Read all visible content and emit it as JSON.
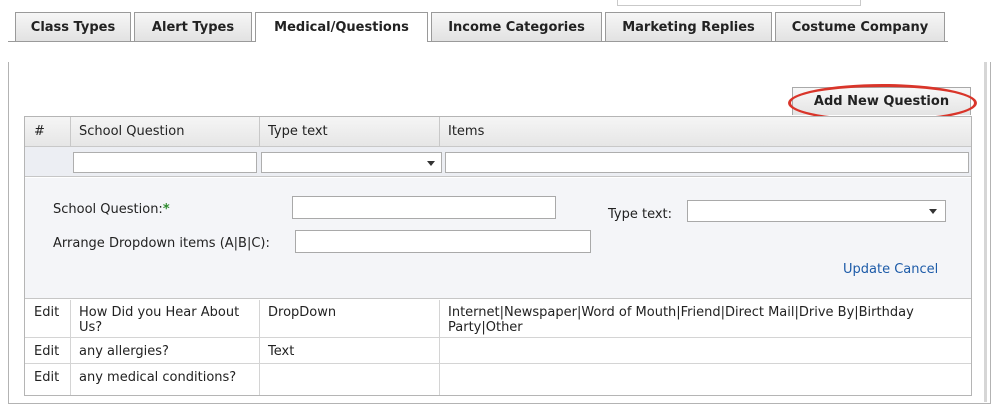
{
  "tabs": [
    {
      "label": "Class Types",
      "active": false
    },
    {
      "label": "Alert Types",
      "active": false
    },
    {
      "label": "Medical/Questions",
      "active": true
    },
    {
      "label": "Income Categories",
      "active": false
    },
    {
      "label": "Marketing Replies",
      "active": false
    },
    {
      "label": "Costume Company",
      "active": false
    }
  ],
  "add_button_label": "Add New Question",
  "grid": {
    "headers": [
      "#",
      "School Question",
      "Type text",
      "Items"
    ],
    "filters": {
      "school_question": "",
      "type_text": "",
      "items": ""
    }
  },
  "edit_form": {
    "question_label": "School Question:",
    "required_mark": "*",
    "question_value": "",
    "type_label": "Type text:",
    "type_value": "",
    "dropdown_items_label": "Arrange Dropdown items (A|B|C):",
    "dropdown_items_value": "",
    "update_label": "Update",
    "cancel_label": "Cancel"
  },
  "rows": [
    {
      "edit": "Edit",
      "question": "How Did you Hear About Us?",
      "type": "DropDown",
      "items": "Internet|Newspaper|Word of Mouth|Friend|Direct Mail|Drive By|Birthday Party|Other"
    },
    {
      "edit": "Edit",
      "question": "any allergies?",
      "type": "Text",
      "items": ""
    },
    {
      "edit": "Edit",
      "question": "any medical conditions?",
      "type": "",
      "items": ""
    }
  ],
  "colors": {
    "link": "#1d5ba8",
    "required": "#2e8b2e",
    "highlight": "#d9352a"
  }
}
